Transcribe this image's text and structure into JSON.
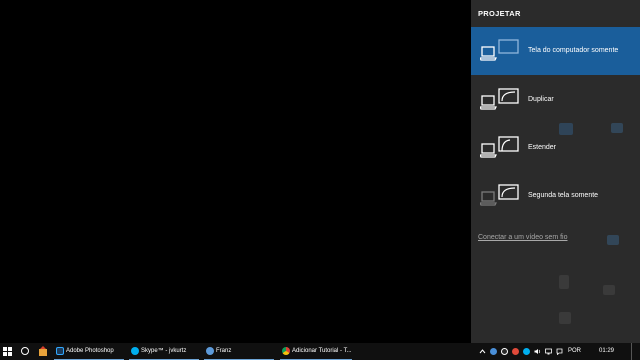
{
  "project": {
    "title": "PROJETAR",
    "options": [
      {
        "label": "Tela do computador somente",
        "icon": "pc-screen-only-icon",
        "selected": true
      },
      {
        "label": "Duplicar",
        "icon": "duplicate-screens-icon",
        "selected": false
      },
      {
        "label": "Estender",
        "icon": "extend-screens-icon",
        "selected": false
      },
      {
        "label": "Segunda tela somente",
        "icon": "second-screen-only-icon",
        "selected": false
      }
    ],
    "wireless_link": "Conectar a um vídeo sem fio"
  },
  "taskbar": {
    "apps": [
      {
        "label": "Adobe Photoshop",
        "icon": "photoshop-icon"
      },
      {
        "label": "Skype™ - jvkurtz",
        "icon": "skype-icon"
      },
      {
        "label": "Franz",
        "icon": "franz-icon"
      },
      {
        "label": "Adicionar Tutorial - T...",
        "icon": "chrome-icon"
      }
    ],
    "tray": {
      "language": "POR",
      "time": "01:29"
    }
  },
  "colors": {
    "pane_bg": "#2b2b2b",
    "selected_bg": "#1a5e9b",
    "taskbar_bg": "#101010",
    "desktop_bg": "#000000"
  }
}
